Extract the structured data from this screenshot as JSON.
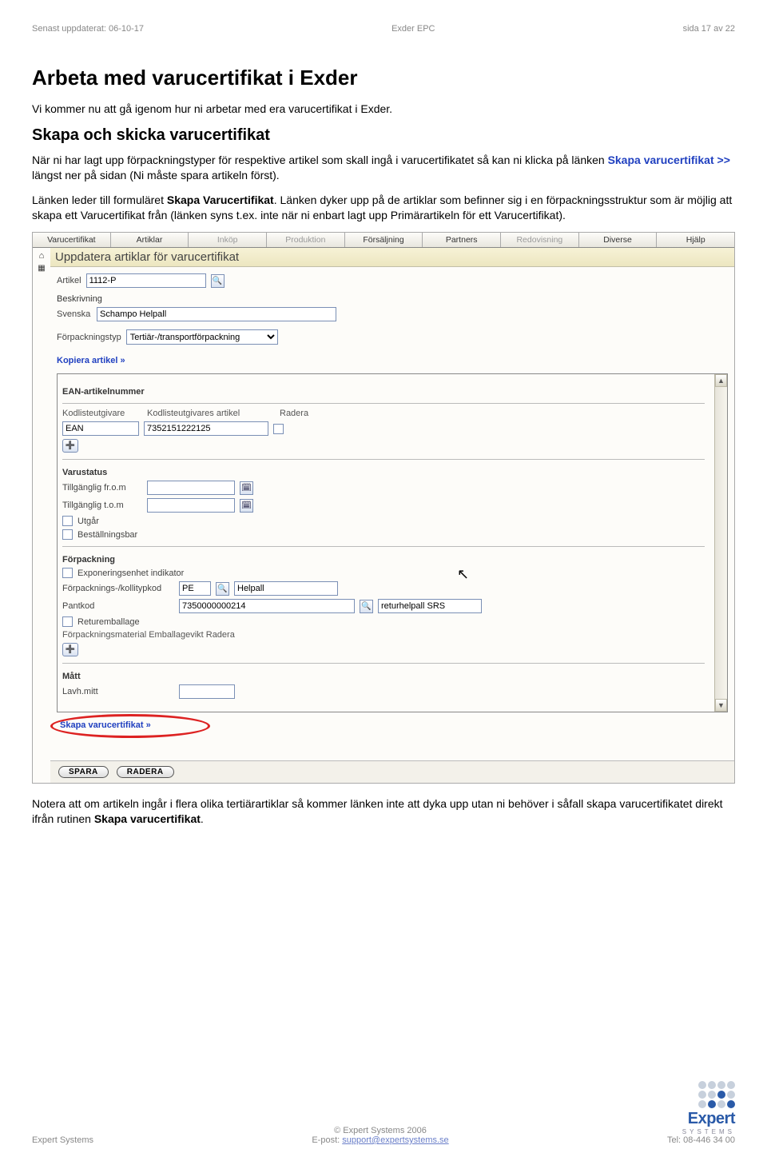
{
  "doc": {
    "header_left": "Senast uppdaterat: 06-10-17",
    "header_center": "Exder EPC",
    "header_right": "sida 17 av 22",
    "h1": "Arbeta med varucertifikat i Exder",
    "p1": "Vi kommer nu att gå igenom hur ni arbetar med era varucertifikat i Exder.",
    "h2": "Skapa och skicka varucertifikat",
    "p2a": "När ni har lagt upp förpackningstyper för respektive artikel som skall ingå i varucertifikatet så kan ni klicka på länken ",
    "p2link": "Skapa varucertifikat >>",
    "p2b": " längst ner på sidan (Ni måste spara artikeln först).",
    "p3a": "Länken leder till formuläret ",
    "p3b1": "Skapa Varucertifikat",
    "p3c": ". Länken dyker upp på de artiklar som befinner sig i en förpackningsstruktur som är möjlig att skapa ett Varucertifikat från (länken syns t.ex. inte när ni enbart lagt upp Primärartikeln för ett Varucertifikat).",
    "footnote_a": "Notera att om artikeln ingår i flera olika tertiärartiklar så kommer länken inte att dyka upp utan ni behöver i såfall skapa varucertifikatet direkt ifrån rutinen ",
    "footnote_b": "Skapa varucertifikat",
    "footnote_c": "."
  },
  "app": {
    "menus": [
      "Varucertifikat",
      "Artiklar",
      "Inköp",
      "Produktion",
      "Försäljning",
      "Partners",
      "Redovisning",
      "Diverse",
      "Hjälp"
    ],
    "menus_disabled_idx": [
      2,
      3,
      6
    ],
    "title": "Uppdatera artiklar för varucertifikat",
    "artikel_label": "Artikel",
    "artikel_value": "1112-P",
    "beskrivning_label": "Beskrivning",
    "svenska_label": "Svenska",
    "svenska_value": "Schampo Helpall",
    "forpackningstyp_label": "Förpackningstyp",
    "forpackningstyp_value": "Tertiär-/transportförpackning",
    "kopiera_link": "Kopiera artikel »",
    "ean_section": "EAN-artikelnummer",
    "ean_col1": "Kodlisteutgivare",
    "ean_col2": "Kodlisteutgivares artikel",
    "ean_col3": "Radera",
    "ean_issuer": "EAN",
    "ean_value": "7352151222125",
    "varustatus": "Varustatus",
    "tillg_from": "Tillgänglig fr.o.m",
    "tillg_tom": "Tillgänglig t.o.m",
    "utgar": "Utgår",
    "bestallningsbar": "Beställningsbar",
    "forpackning": "Förpackning",
    "exponeringsenhet": "Exponeringsenhet indikator",
    "kollitypkod_label": "Förpacknings-/kollitypkod",
    "kollitypkod_val": "PE",
    "kollitypkod_desc": "Helpall",
    "pantkod_label": "Pantkod",
    "pantkod_val": "7350000000214",
    "pantkod_desc": "returhelpall SRS",
    "returemballage": "Returemballage",
    "tablabels": "Förpackningsmaterial Emballagevikt Radera",
    "matt": "Mått",
    "lavhmitt": "Lavh.mitt",
    "skapa_link": "Skapa varucertifikat »",
    "btn_spara": "SPARA",
    "btn_radera": "RADERA"
  },
  "footer": {
    "left": "Expert Systems",
    "center_top": "© Expert Systems 2006",
    "center_label": "E-post: ",
    "center_link": "support@expertsystems.se",
    "right": "Tel: 08-446 34 00",
    "logo_word": "Expert",
    "logo_sub": "SYSTEMS"
  }
}
